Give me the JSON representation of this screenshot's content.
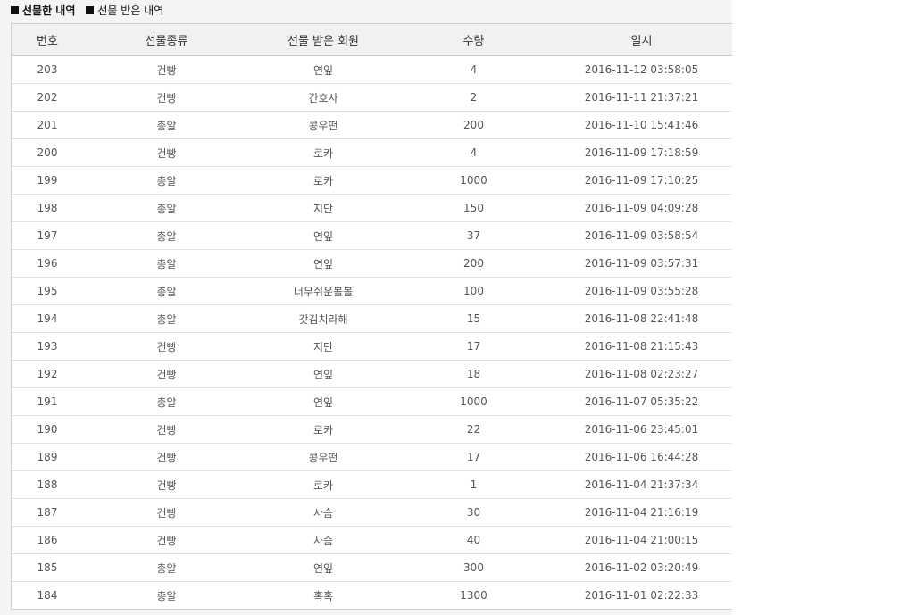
{
  "tabs": [
    {
      "label": "선물한 내역",
      "active": true
    },
    {
      "label": "선물 받은 내역",
      "active": false
    }
  ],
  "table": {
    "headers": [
      "번호",
      "선물종류",
      "선물 받은 회원",
      "수량",
      "일시"
    ],
    "rows": [
      [
        "203",
        "건빵",
        "연잎",
        "4",
        "2016-11-12 03:58:05"
      ],
      [
        "202",
        "건빵",
        "간호사",
        "2",
        "2016-11-11 21:37:21"
      ],
      [
        "201",
        "총알",
        "콩우떤",
        "200",
        "2016-11-10 15:41:46"
      ],
      [
        "200",
        "건빵",
        "로카",
        "4",
        "2016-11-09 17:18:59"
      ],
      [
        "199",
        "총알",
        "로카",
        "1000",
        "2016-11-09 17:10:25"
      ],
      [
        "198",
        "총알",
        "지단",
        "150",
        "2016-11-09 04:09:28"
      ],
      [
        "197",
        "총알",
        "연잎",
        "37",
        "2016-11-09 03:58:54"
      ],
      [
        "196",
        "총알",
        "연잎",
        "200",
        "2016-11-09 03:57:31"
      ],
      [
        "195",
        "총알",
        "너무쉬운볼볼",
        "100",
        "2016-11-09 03:55:28"
      ],
      [
        "194",
        "총알",
        "갓김치라해",
        "15",
        "2016-11-08 22:41:48"
      ],
      [
        "193",
        "건빵",
        "지단",
        "17",
        "2016-11-08 21:15:43"
      ],
      [
        "192",
        "건빵",
        "연잎",
        "18",
        "2016-11-08 02:23:27"
      ],
      [
        "191",
        "총알",
        "연잎",
        "1000",
        "2016-11-07 05:35:22"
      ],
      [
        "190",
        "건빵",
        "로카",
        "22",
        "2016-11-06 23:45:01"
      ],
      [
        "189",
        "건빵",
        "콩우떤",
        "17",
        "2016-11-06 16:44:28"
      ],
      [
        "188",
        "건빵",
        "로카",
        "1",
        "2016-11-04 21:37:34"
      ],
      [
        "187",
        "건빵",
        "사슴",
        "30",
        "2016-11-04 21:16:19"
      ],
      [
        "186",
        "건빵",
        "사슴",
        "40",
        "2016-11-04 21:00:15"
      ],
      [
        "185",
        "총알",
        "연잎",
        "300",
        "2016-11-02 03:20:49"
      ],
      [
        "184",
        "총알",
        "혹혹",
        "1300",
        "2016-11-01 02:22:33"
      ]
    ]
  }
}
